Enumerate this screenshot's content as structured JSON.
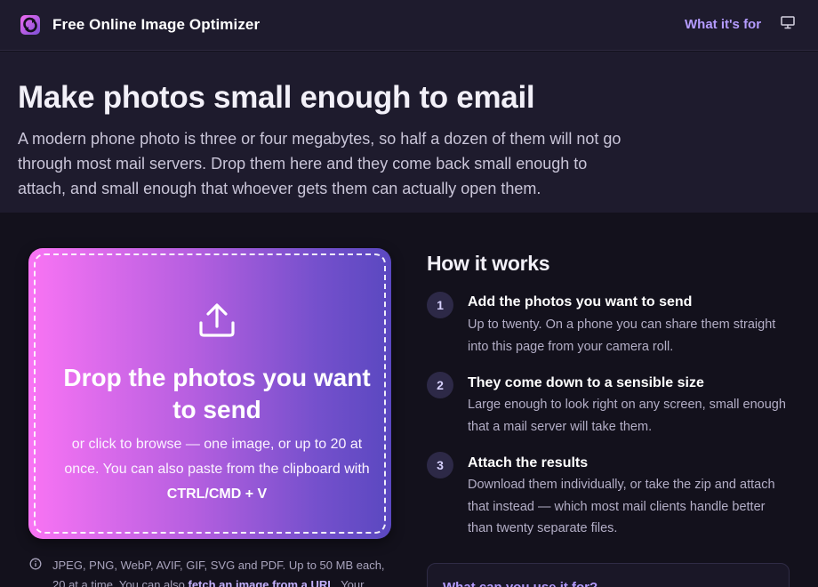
{
  "header": {
    "title": "Free Online Image Optimizer",
    "nav_link": "What it's for",
    "logo_icon": "refresh-arrows-icon",
    "display_icon": "monitor-icon"
  },
  "hero": {
    "heading": "Make photos small enough to email",
    "description": "A modern phone photo is three or four megabytes, so half a dozen of them will not go through most mail servers. Drop them here and they come back small enough to attach, and small enough that whoever gets them can actually open them."
  },
  "dropzone": {
    "icon": "upload-icon",
    "title": "Drop the photos you want to send",
    "subtitle_pre": "or click to browse — one image, or up to 20 at once. You can also paste from the clipboard with ",
    "subtitle_key": "CTRL/CMD + V"
  },
  "info": {
    "icon": "info-icon",
    "text_pre": "JPEG, PNG, WebP, AVIF, GIF, SVG and PDF. Up to 50 MB each, 20 at a time. You can also ",
    "link": "fetch an image from a URL",
    "text_post": ". Your"
  },
  "how": {
    "title": "How it works",
    "steps": [
      {
        "num": "1",
        "title": "Add the photos you want to send",
        "desc": "Up to twenty. On a phone you can share them straight into this page from your camera roll."
      },
      {
        "num": "2",
        "title": "They come down to a sensible size",
        "desc": "Large enough to look right on any screen, small enough that a mail server will take them."
      },
      {
        "num": "3",
        "title": "Attach the results",
        "desc": "Download them individually, or take the zip and attach that instead — which most mail clients handle better than twenty separate files."
      }
    ]
  },
  "card": {
    "title": "What can you use it for?"
  },
  "colors": {
    "accent": "#b59cff",
    "gradient_start": "#f974f4",
    "gradient_end": "#5a48c0",
    "background": "#13111c",
    "header_bg": "#1e1b2d"
  }
}
